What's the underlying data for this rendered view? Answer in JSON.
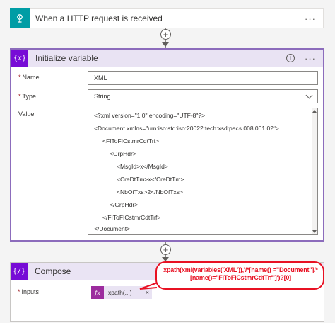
{
  "trigger": {
    "title": "When a HTTP request is received",
    "menu": "···",
    "icon": "http-trigger-icon",
    "accent": "#009da5"
  },
  "connectors": {
    "add_label": "+"
  },
  "init_var": {
    "title": "Initialize variable",
    "icon_text": "{x}",
    "info": "i",
    "menu": "···",
    "accent": "#770bd6",
    "name_label": "Name",
    "name_value": "XML",
    "type_label": "Type",
    "type_value": "String",
    "value_label": "Value",
    "required_mark": "*",
    "value_lines": [
      "<?xml version=\"1.0\" encoding=\"UTF-8\"?>",
      "<Document xmlns=\"urn:iso:std:iso:20022:tech:xsd:pacs.008.001.02\">",
      "<FIToFICstmrCdtTrf>",
      "<GrpHdr>",
      "<MsgId>x</MsgId>",
      "<CreDtTm>x</CreDtTm>",
      "<NbOfTxs>2</NbOfTxs>",
      "</GrpHdr>",
      "</FIToFICstmrCdtTrf>",
      "</Document>"
    ]
  },
  "compose": {
    "title": "Compose",
    "icon_text": "{/}",
    "inputs_label": "Inputs",
    "required_mark": "*",
    "token_icon": "fx",
    "token_label": "xpath(...)",
    "token_close": "×"
  },
  "callout": {
    "text": "xpath(xml(variables('XML')),'/*[name() =\"Document\"]/*[name()=\"FIToFICstmrCdtTrf\"]')?[0]",
    "color": "#e81123"
  }
}
